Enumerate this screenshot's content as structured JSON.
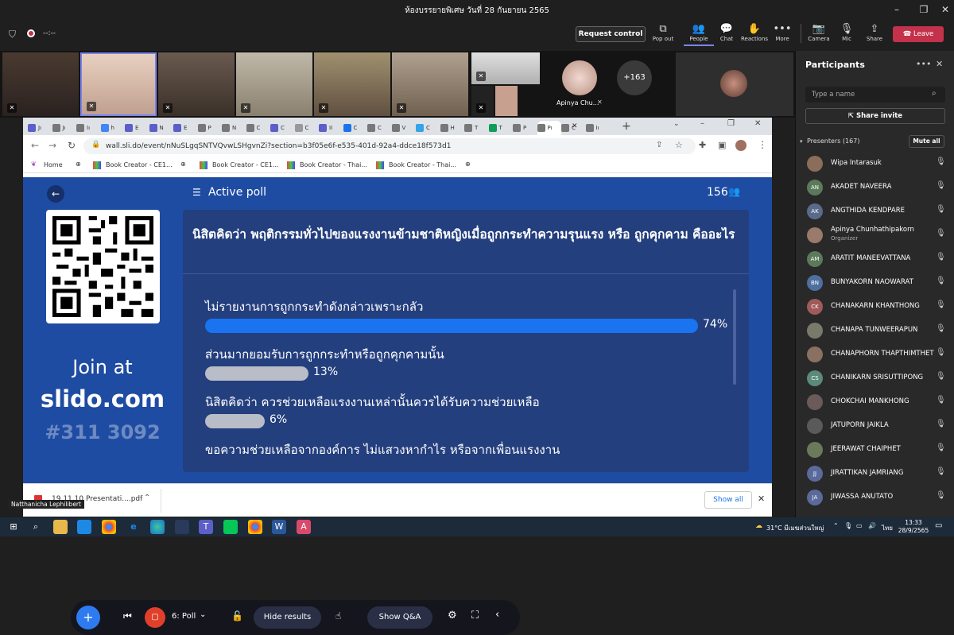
{
  "window": {
    "title": "ห้องบรรยายพิเศษ วันที่ 28 กันยายน 2565"
  },
  "teams_toolbar": {
    "timer": "--:--",
    "request_control": "Request control",
    "buttons": [
      {
        "label": "Pop out",
        "icon": "popout-icon"
      },
      {
        "label": "People",
        "icon": "people-icon"
      },
      {
        "label": "Chat",
        "icon": "chat-icon"
      },
      {
        "label": "Reactions",
        "icon": "reactions-icon"
      },
      {
        "label": "More",
        "icon": "more-icon"
      },
      {
        "label": "Camera",
        "icon": "camera-off-icon"
      },
      {
        "label": "Mic",
        "icon": "mic-off-icon"
      },
      {
        "label": "Share",
        "icon": "share-icon"
      }
    ],
    "leave": "Leave"
  },
  "video_strip": {
    "more_count": "+163",
    "named_tile": "Apinya Chu..."
  },
  "browser": {
    "url": "wall.sli.do/event/nNuSLgqSNTVQvwLSHgvnZi?section=b3f05e6f-e535-401d-92a4-ddce18f573d1",
    "tabs": [
      "Jı",
      "Jı",
      "Iı",
      "h",
      "E",
      "N",
      "E",
      "P",
      "N",
      "C",
      "C",
      "C",
      "II",
      "C",
      "C",
      "V",
      "C",
      "H",
      "T",
      "T",
      "P",
      "Pı",
      "C",
      "Iı"
    ],
    "bookmarks": [
      "Home",
      "Book Creator - CE1...",
      "Book Creator - CE1...",
      "Book Creator - Thai...",
      "Book Creator - Thai..."
    ],
    "download_file": "19.11.10 Presentati....pdf",
    "show_all": "Show all"
  },
  "slido": {
    "header": "Active poll",
    "participants": "156",
    "join_at": "Join at",
    "site": "slido.com",
    "code": "#311 3092",
    "question": "นิสิตคิดว่า พฤติกรรมทั่วไปของแรงงานข้ามชาติหญิงเมื่อถูกกระทำความรุนแรง หรือ ถูกคุกคาม คืออะไร",
    "options": [
      {
        "label": "ไม่รายงานการถูกกระทำดังกล่าวเพราะกลัว",
        "pct": "74%",
        "value": 74
      },
      {
        "label": "ส่วนมากยอมรับการถูกกระทำหรือถูกคุกคามนั้น",
        "pct": "13%",
        "value": 13
      },
      {
        "label": "นิสิตคิดว่า ควรช่วยเหลือแรงงานเหล่านั้นควรได้รับความช่วยเหลือ",
        "pct": "6%",
        "value": 6
      },
      {
        "label": "ขอความช่วยเหลือจากองค์การ ไม่แสวงหากำไร หรือจากเพื่อนแรงงาน",
        "pct": "",
        "value": 0
      }
    ],
    "controls": {
      "poll": "6: Poll",
      "hide_results": "Hide results",
      "show_qa": "Show Q&A"
    }
  },
  "presenter_label": "Natthanicha Lephilibert",
  "participants_panel": {
    "title": "Participants",
    "search_placeholder": "Type a name",
    "share_invite": "Share invite",
    "section": "Presenters (167)",
    "mute_all": "Mute all",
    "people": [
      {
        "name": "Wipa Intarasuk",
        "initials": "",
        "color": "#8a6d5a",
        "role": ""
      },
      {
        "name": "AKADET NAVEERA",
        "initials": "AN",
        "color": "#5b7a5a",
        "role": ""
      },
      {
        "name": "ANGTHIDA KENDPARE",
        "initials": "AK",
        "color": "#5a6b8a",
        "role": ""
      },
      {
        "name": "Apinya Chunhathipakorn",
        "initials": "",
        "color": "#9a7a6a",
        "role": "Organizer"
      },
      {
        "name": "ARATIT MANEEVATTANA",
        "initials": "AM",
        "color": "#5b7a5a",
        "role": ""
      },
      {
        "name": "BUNYAKORN NAOWARAT",
        "initials": "BN",
        "color": "#4f6fa0",
        "role": ""
      },
      {
        "name": "CHANAKARN KHANTHONG",
        "initials": "CK",
        "color": "#a05a5a",
        "role": ""
      },
      {
        "name": "CHANAPA TUNWEERAPUN",
        "initials": "",
        "color": "#7a7a6a",
        "role": ""
      },
      {
        "name": "CHANAPHORN THAPTHIMTHET",
        "initials": "",
        "color": "#8a7060",
        "role": ""
      },
      {
        "name": "CHANIKARN SRISUTTIPONG",
        "initials": "CS",
        "color": "#5b8a7a",
        "role": ""
      },
      {
        "name": "CHOKCHAI MANKHONG",
        "initials": "",
        "color": "#6a5a5a",
        "role": ""
      },
      {
        "name": "JATUPORN JAIKLA",
        "initials": "",
        "color": "#5a5a5a",
        "role": ""
      },
      {
        "name": "JEERAWAT CHAIPHET",
        "initials": "",
        "color": "#6a7a5a",
        "role": ""
      },
      {
        "name": "JIRATTIKAN JAMRIANG",
        "initials": "JJ",
        "color": "#5a6a9a",
        "role": ""
      },
      {
        "name": "JIWASSA ANUTATO",
        "initials": "JA",
        "color": "#5a6a9a",
        "role": ""
      }
    ]
  },
  "taskbar": {
    "weather": "31°C มีเมฆส่วนใหญ่",
    "lang": "ไทย",
    "time": "13:33",
    "date": "28/9/2565"
  }
}
